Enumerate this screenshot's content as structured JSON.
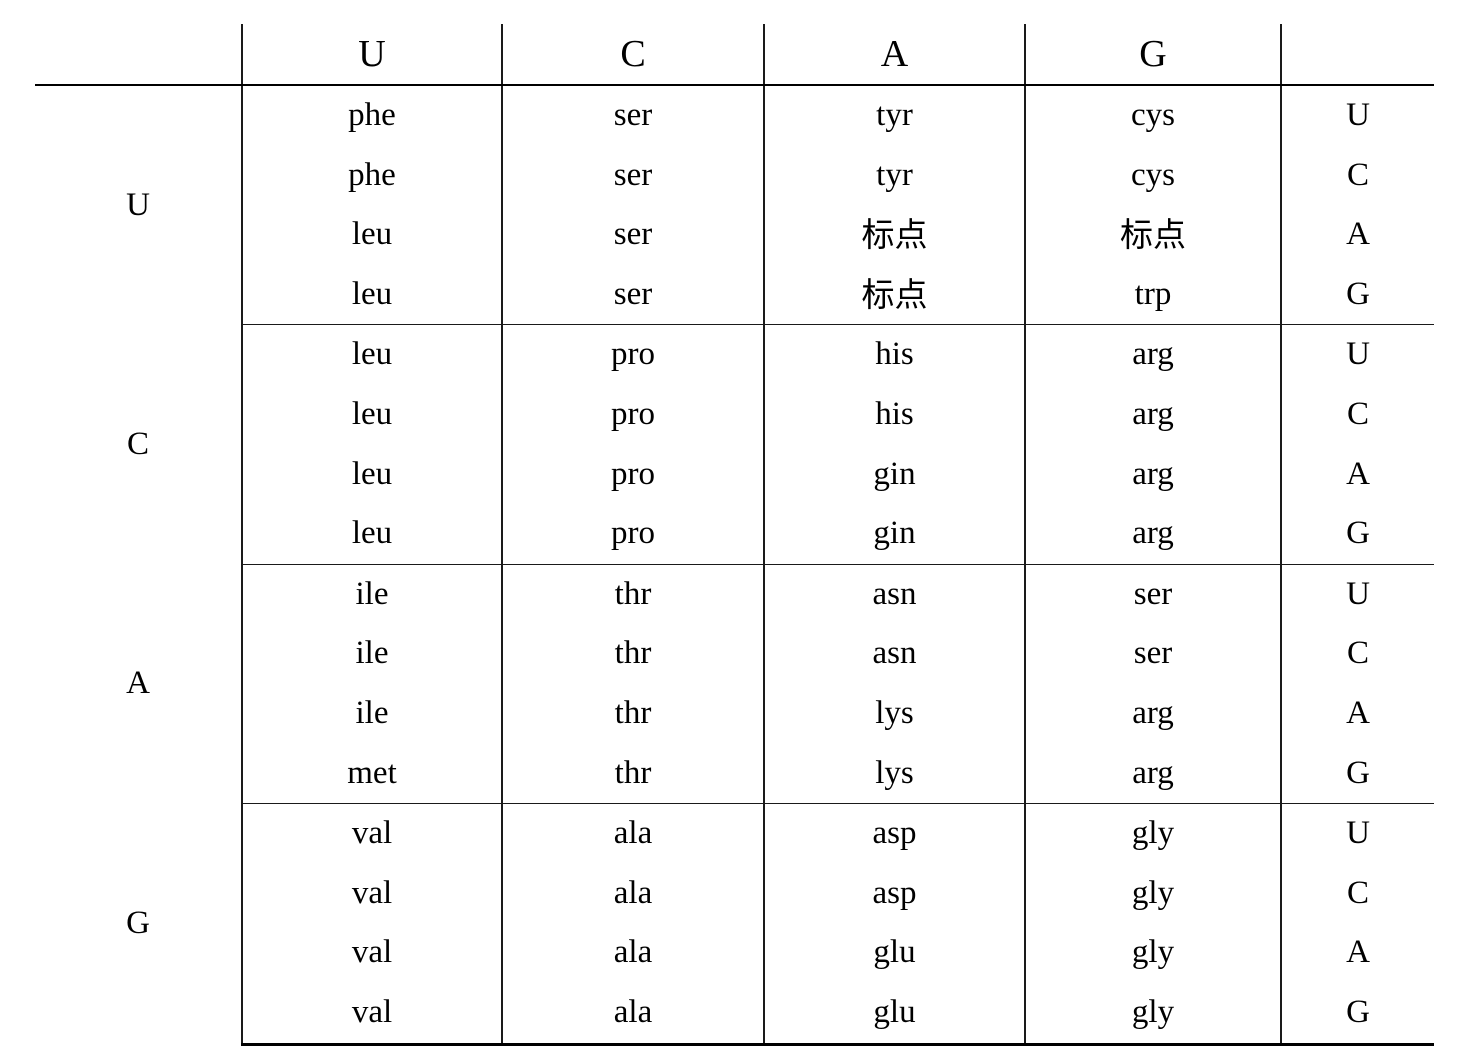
{
  "table": {
    "name": "genetic-codon-table",
    "header": {
      "corner_label": "",
      "columns": [
        "U",
        "C",
        "A",
        "G"
      ],
      "third_base_header": ""
    },
    "third_base_sequence": [
      "U",
      "C",
      "A",
      "G"
    ],
    "blocks": [
      {
        "first_base": "U",
        "rows": [
          {
            "third_base": "U",
            "cells": [
              "phe",
              "ser",
              "tyr",
              "cys"
            ]
          },
          {
            "third_base": "C",
            "cells": [
              "phe",
              "ser",
              "tyr",
              "cys"
            ]
          },
          {
            "third_base": "A",
            "cells": [
              "leu",
              "ser",
              "标点",
              "标点"
            ]
          },
          {
            "third_base": "G",
            "cells": [
              "leu",
              "ser",
              "标点",
              "trp"
            ]
          }
        ]
      },
      {
        "first_base": "C",
        "rows": [
          {
            "third_base": "U",
            "cells": [
              "leu",
              "pro",
              "his",
              "arg"
            ]
          },
          {
            "third_base": "C",
            "cells": [
              "leu",
              "pro",
              "his",
              "arg"
            ]
          },
          {
            "third_base": "A",
            "cells": [
              "leu",
              "pro",
              "gin",
              "arg"
            ]
          },
          {
            "third_base": "G",
            "cells": [
              "leu",
              "pro",
              "gin",
              "arg"
            ]
          }
        ]
      },
      {
        "first_base": "A",
        "rows": [
          {
            "third_base": "U",
            "cells": [
              "ile",
              "thr",
              "asn",
              "ser"
            ]
          },
          {
            "third_base": "C",
            "cells": [
              "ile",
              "thr",
              "asn",
              "ser"
            ]
          },
          {
            "third_base": "A",
            "cells": [
              "ile",
              "thr",
              "lys",
              "arg"
            ]
          },
          {
            "third_base": "G",
            "cells": [
              "met",
              "thr",
              "lys",
              "arg"
            ]
          }
        ]
      },
      {
        "first_base": "G",
        "rows": [
          {
            "third_base": "U",
            "cells": [
              "val",
              "ala",
              "asp",
              "gly"
            ]
          },
          {
            "third_base": "C",
            "cells": [
              "val",
              "ala",
              "asp",
              "gly"
            ]
          },
          {
            "third_base": "A",
            "cells": [
              "val",
              "ala",
              "glu",
              "gly"
            ]
          },
          {
            "third_base": "G",
            "cells": [
              "val",
              "ala",
              "glu",
              "gly"
            ]
          }
        ]
      }
    ]
  },
  "colors": {
    "rule": "#000000",
    "divider": "#1a1a1a",
    "text": "#000000",
    "background": "#ffffff"
  }
}
